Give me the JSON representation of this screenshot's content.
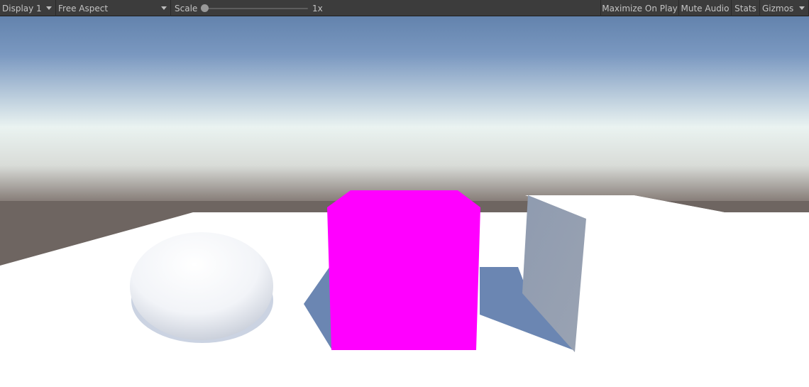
{
  "toolbar": {
    "display": {
      "label": "Display 1",
      "icon": "chevron-down-icon"
    },
    "aspect": {
      "label": "Free Aspect",
      "icon": "chevron-down-icon"
    },
    "scale": {
      "label": "Scale",
      "value_label": "1x",
      "value": 1
    },
    "buttons": {
      "maximize_on_play": "Maximize On Play",
      "mute_audio": "Mute Audio",
      "stats": "Stats",
      "gizmos": "Gizmos",
      "gizmos_icon": "chevron-down-icon"
    }
  },
  "viewport": {
    "colors": {
      "sky_top": "#6686b0",
      "horizon": "#eef5f3",
      "ground": "#6e6561",
      "floor": "#ffffff",
      "cube": "#ff00ff",
      "shadow": "#6b86b2",
      "quad": "#8c99ad"
    }
  }
}
